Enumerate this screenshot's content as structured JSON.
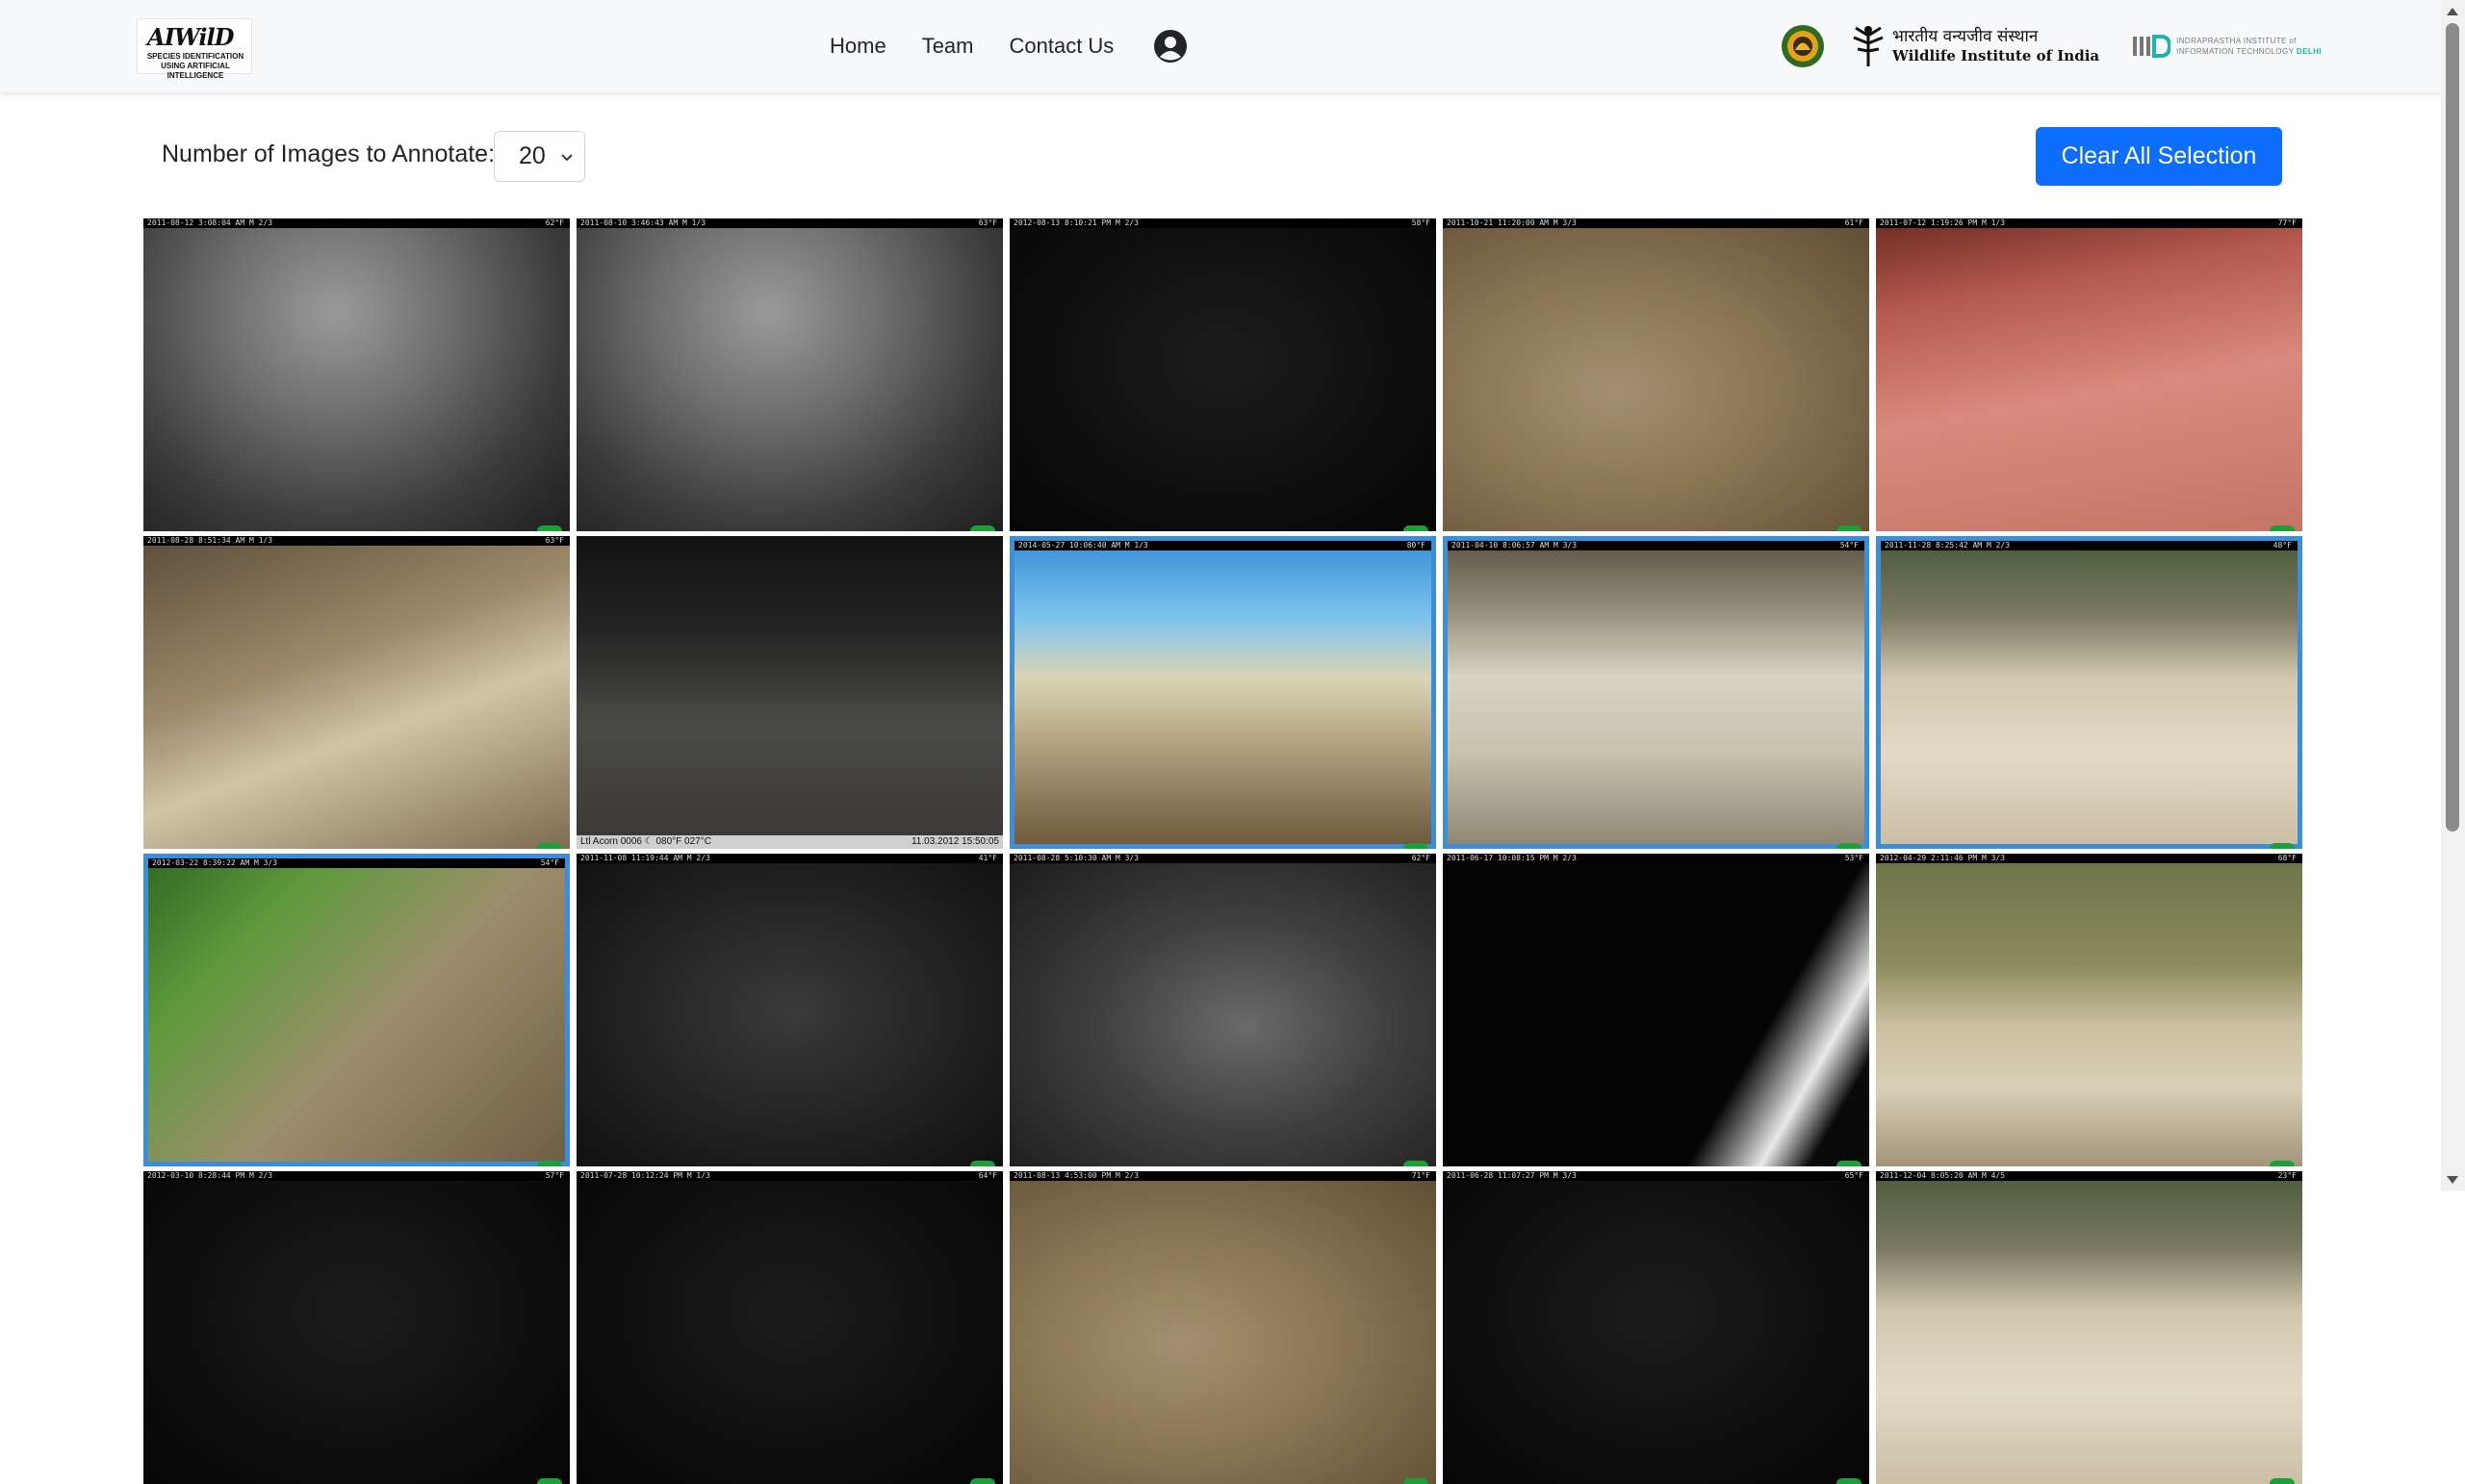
{
  "brand": {
    "title": "AIWilD",
    "subtitle": "SPECIES IDENTIFICATION USING ARTIFICIAL INTELLIGENCE"
  },
  "nav": {
    "items": [
      {
        "label": "Home"
      },
      {
        "label": "Team"
      },
      {
        "label": "Contact Us"
      }
    ],
    "user_icon": "user-circle-icon"
  },
  "partners": {
    "wii_hindi": "भारतीय वन्यजीव संस्थान",
    "wii_english": "Wildlife Institute of India",
    "iiitd_line1": "INDRAPRASTHA INSTITUTE of",
    "iiitd_line2": "INFORMATION TECHNOLOGY",
    "iiitd_city": "DELHI"
  },
  "annotate": {
    "label": "Number of Images to Annotate:",
    "value": "20"
  },
  "clear_button": "Clear All Selection",
  "colors": {
    "primary": "#0d6efd",
    "selection": "#3d8ed8",
    "navbar_bg": "#f8f9fa"
  },
  "images": [
    {
      "stamp": "2011-08-12 3:08:04 AM  M 2/3",
      "temp": "62°F",
      "scene": "ir-wall",
      "selected": false
    },
    {
      "stamp": "2011-08-10 3:46:43 AM  M 1/3",
      "temp": "63°F",
      "scene": "ir-wall",
      "selected": false
    },
    {
      "stamp": "2012-08-13 8:10:21 PM  M 2/3",
      "temp": "58°F",
      "scene": "dark",
      "selected": false
    },
    {
      "stamp": "2011-10-21 11:20:00 AM  M 3/3",
      "temp": "61°F",
      "scene": "ground",
      "selected": false
    },
    {
      "stamp": "2011-07-12 1:19:26 PM  M 1/3",
      "temp": "77°F",
      "scene": "red",
      "selected": false
    },
    {
      "stamp": "2011-08-28 8:51:34 AM  M 1/3",
      "temp": "63°F",
      "scene": "shade",
      "selected": false
    },
    {
      "stamp": "",
      "temp": "",
      "scene": "underpass",
      "selected": false,
      "footer_left": "Ltl Acorn 0006   ☾ 080°F 027°C",
      "footer_right": "11.03.2012 15:50:05"
    },
    {
      "stamp": "2014-05-27 10:06:40 AM  M 1/3",
      "temp": "80°F",
      "scene": "rocks",
      "selected": true
    },
    {
      "stamp": "2011-04-10 8:06:57 AM  M 3/3",
      "temp": "54°F",
      "scene": "culvert",
      "selected": true
    },
    {
      "stamp": "2011-11-28 8:25:42 AM  M 2/3",
      "temp": "48°F",
      "scene": "sand",
      "selected": true
    },
    {
      "stamp": "2012-03-22 8:39:22 AM  M 3/3",
      "temp": "54°F",
      "scene": "green",
      "selected": true
    },
    {
      "stamp": "2011-11-08 11:19:44 AM  M 2/3",
      "temp": "41°F",
      "scene": "ir-dark",
      "selected": false
    },
    {
      "stamp": "2011-08-28 5:10:30 AM  M 3/3",
      "temp": "62°F",
      "scene": "ir-grass",
      "selected": false
    },
    {
      "stamp": "2011-06-17 10:08:15 PM  M 2/3",
      "temp": "53°F",
      "scene": "black-pole",
      "selected": false
    },
    {
      "stamp": "2012-04-29 2:11:46 PM  M 3/3",
      "temp": "68°F",
      "scene": "riverbank",
      "selected": false
    },
    {
      "stamp": "2012-03-10 8:28:44 PM  M 2/3",
      "temp": "57°F",
      "scene": "dark",
      "selected": false
    },
    {
      "stamp": "2011-07-28 10:12:24 PM  M 1/3",
      "temp": "64°F",
      "scene": "dark",
      "selected": false
    },
    {
      "stamp": "2011-08-13 4:53:00 PM  M 2/3",
      "temp": "71°F",
      "scene": "ground",
      "selected": false
    },
    {
      "stamp": "2011-06-28 11:07:27 PM  M 3/3",
      "temp": "65°F",
      "scene": "dark",
      "selected": false
    },
    {
      "stamp": "2011-12-04 8:05:20 AM  M 4/5",
      "temp": "23°F",
      "scene": "sand",
      "selected": false
    }
  ]
}
